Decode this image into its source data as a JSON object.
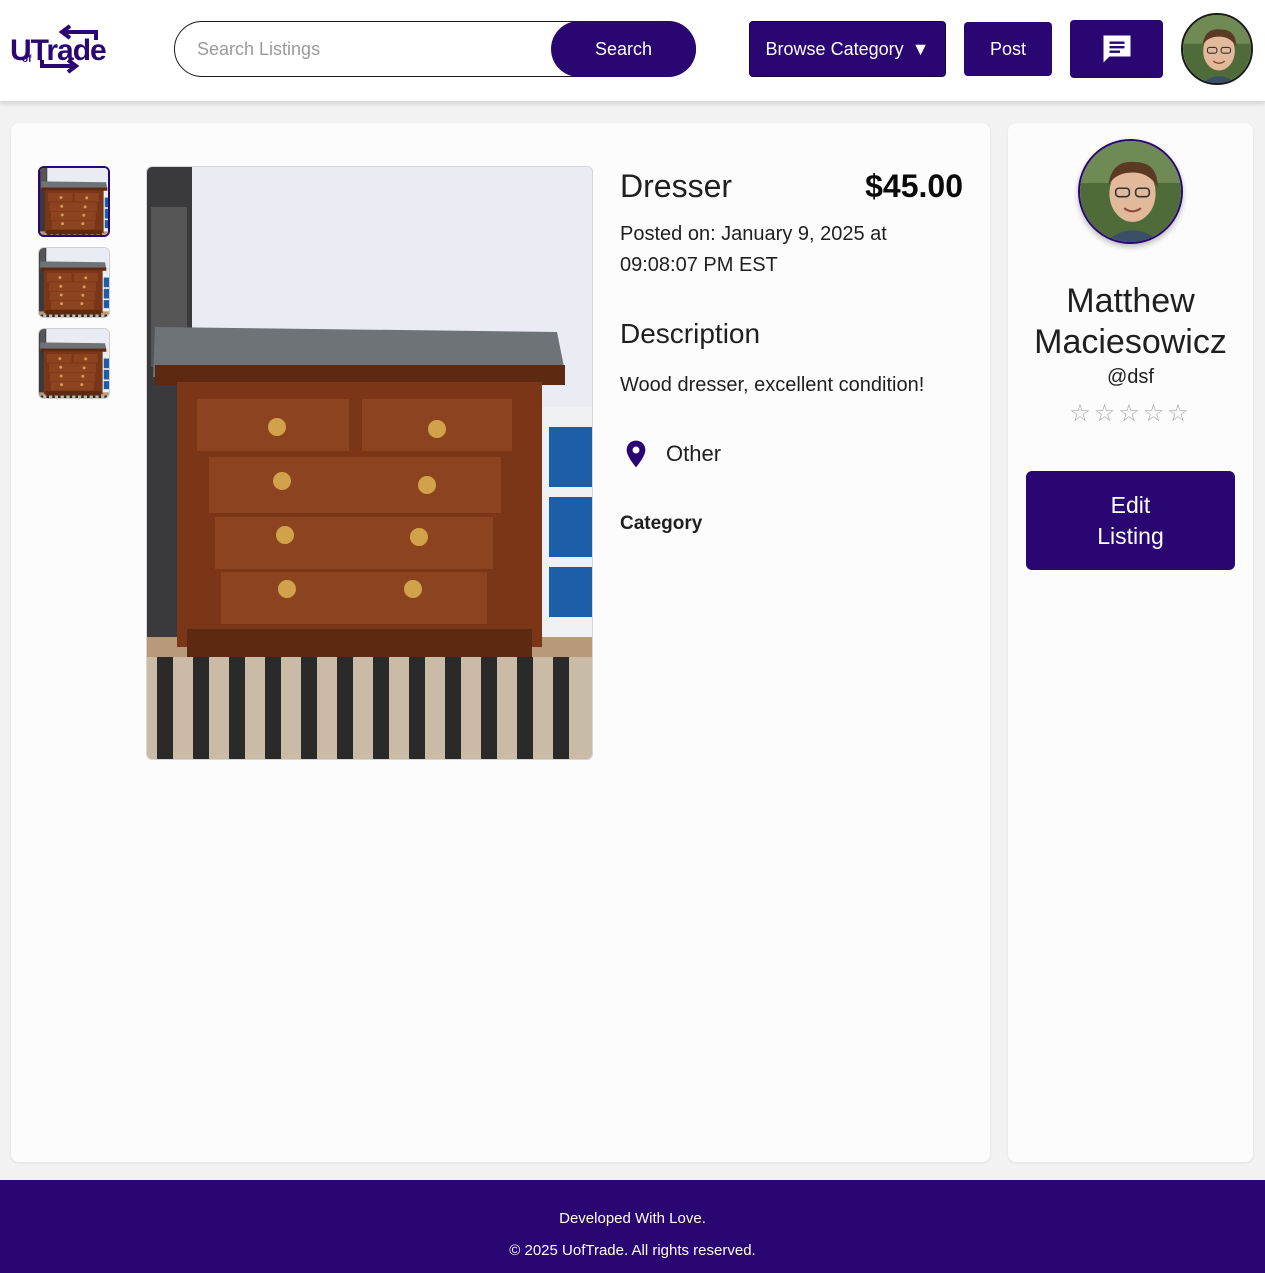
{
  "header": {
    "logo_text": "UTrade",
    "logo_small": "of",
    "search_placeholder": "Search Listings",
    "search_value": "",
    "search_button": "Search",
    "browse_button": "Browse Category",
    "browse_caret": "▼",
    "post_button": "Post",
    "messages_icon": "chat-icon",
    "avatar_icon": "profile-photo"
  },
  "listing": {
    "title": "Dresser",
    "price": "$45.00",
    "posted": "Posted on: January 9, 2025 at 09:08:07 PM EST",
    "description_heading": "Description",
    "description": "Wood dresser, excellent condition!",
    "location_icon": "map-pin-icon",
    "location": "Other",
    "category_label": "Category",
    "thumbnail_count": 3
  },
  "seller": {
    "name": "Matthew Maciesowicz",
    "handle": "@dsf",
    "rating_stars": "☆☆☆☆☆",
    "rating_value": 0,
    "edit_button": "Edit Listing"
  },
  "footer": {
    "line1": "Developed With Love.",
    "line2": "© 2025 UofTrade. All rights reserved."
  },
  "colors": {
    "brand": "#2a0673",
    "star": "#a9a9a9"
  }
}
